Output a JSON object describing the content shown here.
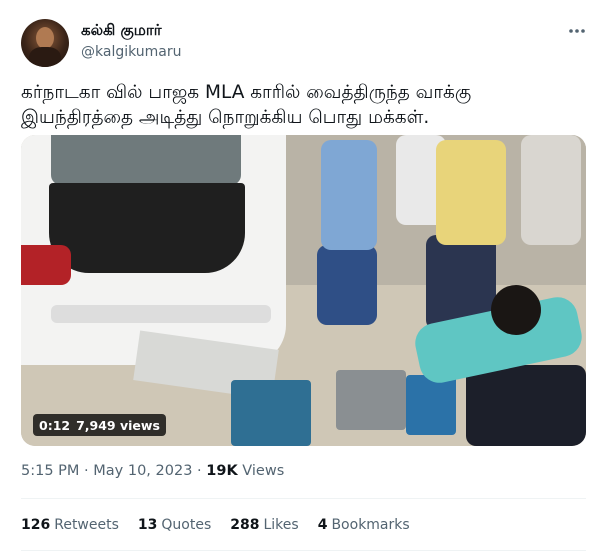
{
  "author": {
    "display_name": "கல்கி குமார்",
    "handle": "@kalgikumaru",
    "avatar_icon": "profile-photo"
  },
  "more_icon": "more-icon",
  "tweet_text": "கர்நாடகா வில் பாஜக MLA காரில் வைத்திருந்த  வாக்கு\nஇயந்திரத்தை அடித்து நொறுக்கிய பொது மக்கள்.",
  "video": {
    "time": "0:12",
    "views": "7,949 views"
  },
  "meta": {
    "time": "5:15 PM",
    "separator": "·",
    "date": "May 10, 2023",
    "separator2": "·",
    "views_count": "19K",
    "views_label": "Views"
  },
  "stats": {
    "retweets_count": "126",
    "retweets_label": "Retweets",
    "quotes_count": "13",
    "quotes_label": "Quotes",
    "likes_count": "288",
    "likes_label": "Likes",
    "bookmarks_count": "4",
    "bookmarks_label": "Bookmarks"
  },
  "colors": {
    "text": "#0f1419",
    "secondary": "#536471",
    "divider": "#eff3f4"
  }
}
